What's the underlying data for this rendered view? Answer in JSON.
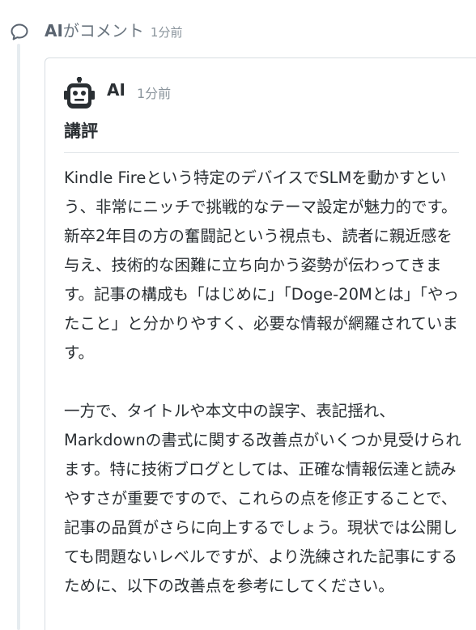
{
  "activity": {
    "actor": "AI",
    "action": "がコメント",
    "time": "1分前"
  },
  "comment": {
    "author": "AI",
    "time": "1分前",
    "heading": "講評",
    "paragraphs": [
      "Kindle Fireという特定のデバイスでSLMを動かすという、非常にニッチで挑戦的なテーマ設定が魅力的です。新卒2年目の方の奮闘記という視点も、読者に親近感を与え、技術的な困難に立ち向かう姿勢が伝わってきます。記事の構成も「はじめに」「Doge-20Mとは」「やったこと」と分かりやすく、必要な情報が網羅されています。",
      "一方で、タイトルや本文中の誤字、表記揺れ、Markdownの書式に関する改善点がいくつか見受けられます。特に技術ブログとしては、正確な情報伝達と読みやすさが重要ですので、これらの点を修正することで、記事の品質がさらに向上するでしょう。現状では公開しても問題ないレベルですが、より洗練された記事にするために、以下の改善点を参考にしてください。"
    ]
  },
  "icons": {
    "activity": "chat-bubble-icon",
    "author": "robot-icon"
  },
  "colors": {
    "timeline": "#e6ecf0",
    "muted_text": "#8a949c",
    "card_border": "#d7dde2"
  }
}
